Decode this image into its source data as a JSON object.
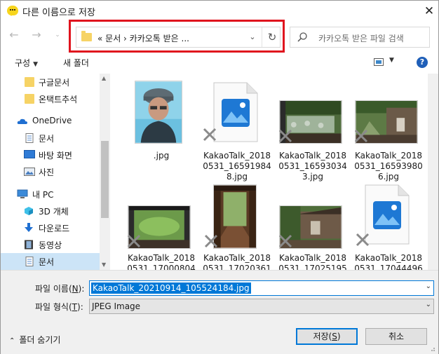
{
  "window": {
    "title": "다른 이름으로 저장",
    "close_glyph": "✕"
  },
  "nav": {
    "back_glyph": "←",
    "forward_glyph": "→",
    "up_glyph": "↑",
    "address_path": "«  문서  ›  카카오톡 받은 ...",
    "dropdown_glyph": "⌄",
    "refresh_glyph": "↻",
    "search_placeholder": "카카오톡 받은 파일 검색"
  },
  "toolbar": {
    "organize_label": "구성",
    "new_folder_label": "새 폴더",
    "help_glyph": "?"
  },
  "sidebar": {
    "items": [
      {
        "label": "구글문서",
        "icon": "folder-icon"
      },
      {
        "label": "온택트추석",
        "icon": "folder-icon"
      },
      {
        "label": "OneDrive",
        "icon": "cloud-icon"
      },
      {
        "label": "문서",
        "icon": "document-icon"
      },
      {
        "label": "바탕 화면",
        "icon": "desktop-icon"
      },
      {
        "label": "사진",
        "icon": "pictures-icon"
      },
      {
        "label": "내 PC",
        "icon": "computer-icon"
      },
      {
        "label": "3D 개체",
        "icon": "cube-icon"
      },
      {
        "label": "다운로드",
        "icon": "download-icon"
      },
      {
        "label": "동영상",
        "icon": "video-icon"
      },
      {
        "label": "문서",
        "icon": "document-icon"
      }
    ],
    "selected_index": 10
  },
  "files": [
    {
      "label": ".jpg",
      "kind": "person-photo"
    },
    {
      "label": "KakaoTalk_20180531_165919848.jpg",
      "label_lines": [
        "KakaoTalk_2018",
        "0531_16591984",
        "8.jpg"
      ],
      "kind": "placeholder"
    },
    {
      "label": "KakaoTalk_20180531_165930343.jpg",
      "label_lines": [
        "KakaoTalk_2018",
        "0531_16593034",
        "3.jpg"
      ],
      "kind": "garden-photo"
    },
    {
      "label": "KakaoTalk_20180531_165939806.jpg",
      "label_lines": [
        "KakaoTalk_2018",
        "0531_16593980",
        "6.jpg"
      ],
      "kind": "garden-photo-2"
    },
    {
      "label": "KakaoTalk_20180531_17000804",
      "label_lines": [
        "KakaoTalk_2018",
        "0531_17000804"
      ],
      "kind": "courtyard-photo"
    },
    {
      "label": "KakaoTalk_20180531_17020361",
      "label_lines": [
        "KakaoTalk_2018",
        "0531_17020361"
      ],
      "kind": "corridor-photo"
    },
    {
      "label": "KakaoTalk_20180531_17025195",
      "label_lines": [
        "KakaoTalk_2018",
        "0531_17025195"
      ],
      "kind": "house-photo"
    },
    {
      "label": "KakaoTalk_20180531_17044496",
      "label_lines": [
        "KakaoTalk_2018",
        "0531_17044496"
      ],
      "kind": "placeholder"
    }
  ],
  "form": {
    "filename_label": "파일 이름",
    "filename_accel": "N",
    "filename_value": "KakaoTalk_20210914_105524184.jpg",
    "filetype_label": "파일 형식",
    "filetype_accel": "T",
    "filetype_value": "JPEG Image",
    "hide_folders_label": "폴더 숨기기",
    "save_label": "저장",
    "save_accel": "S",
    "cancel_label": "취소"
  },
  "colors": {
    "accent": "#0078d7",
    "selected_bg": "#cce4f7",
    "highlight_border": "#e0141e",
    "folder": "#f6d365"
  }
}
